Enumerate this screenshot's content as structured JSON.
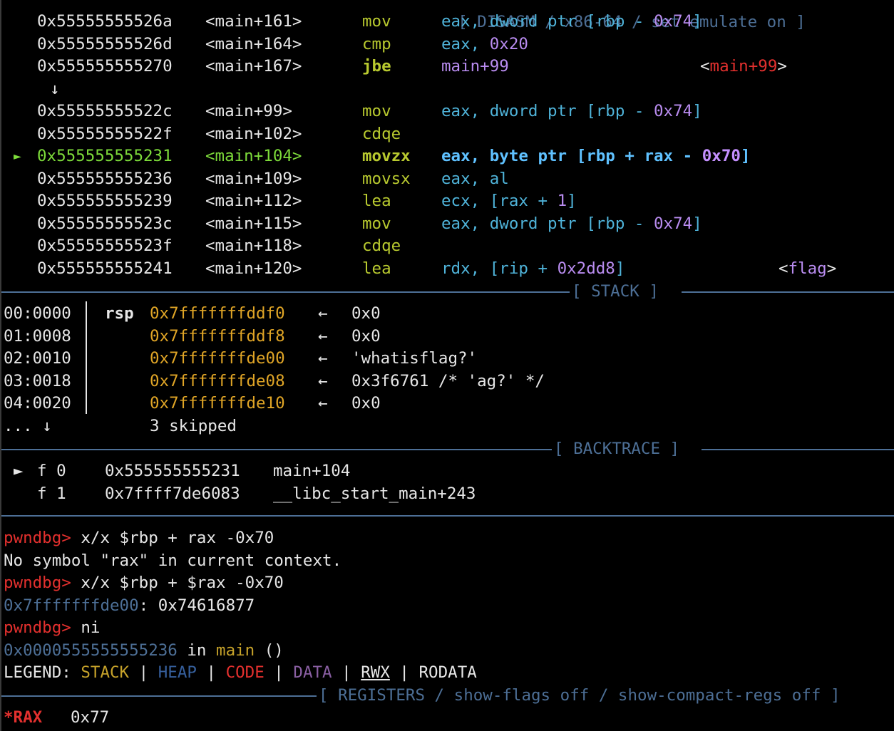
{
  "disasm": {
    "header": "[ DISASM / x86-64 / set emulate on ]",
    "rows": [
      {
        "addr": "0x55555555526a",
        "sym": "<main+161>",
        "mnem": "mov",
        "ops": [
          [
            "reg",
            "eax, dword ptr [rbp - "
          ],
          [
            "num",
            "0x74"
          ],
          [
            "reg",
            "]"
          ]
        ],
        "comment": ""
      },
      {
        "addr": "0x55555555526d",
        "sym": "<main+164>",
        "mnem": "cmp",
        "ops": [
          [
            "reg",
            "eax, "
          ],
          [
            "num",
            "0x20"
          ]
        ],
        "comment": ""
      },
      {
        "addr": "0x555555555270",
        "sym": "<main+167>",
        "mnem": "jbe",
        "ops": [
          [
            "num",
            "main+99"
          ]
        ],
        "comment": "<main+99>"
      },
      {
        "addr": "",
        "sym": "",
        "mnem": "",
        "ops": [],
        "comment": "",
        "arrow": "↓"
      },
      {
        "addr": "0x55555555522c",
        "sym": "<main+99>",
        "mnem": "mov",
        "ops": [
          [
            "reg",
            "eax, dword ptr [rbp - "
          ],
          [
            "num",
            "0x74"
          ],
          [
            "reg",
            "]"
          ]
        ],
        "comment": ""
      },
      {
        "addr": "0x55555555522f",
        "sym": "<main+102>",
        "mnem": "cdqe",
        "ops": [],
        "comment": ""
      },
      {
        "addr": "0x555555555231",
        "sym": "<main+104>",
        "mnem": "movzx",
        "ops": [
          [
            "reg",
            "eax, byte ptr [rbp + rax - "
          ],
          [
            "num",
            "0x70"
          ],
          [
            "reg",
            "]"
          ]
        ],
        "comment": "",
        "current": true
      },
      {
        "addr": "0x555555555236",
        "sym": "<main+109>",
        "mnem": "movsx",
        "ops": [
          [
            "reg",
            "eax, al"
          ]
        ],
        "comment": ""
      },
      {
        "addr": "0x555555555239",
        "sym": "<main+112>",
        "mnem": "lea",
        "ops": [
          [
            "reg",
            "ecx, [rax + "
          ],
          [
            "num",
            "1"
          ],
          [
            "reg",
            "]"
          ]
        ],
        "comment": ""
      },
      {
        "addr": "0x55555555523c",
        "sym": "<main+115>",
        "mnem": "mov",
        "ops": [
          [
            "reg",
            "eax, dword ptr [rbp - "
          ],
          [
            "num",
            "0x74"
          ],
          [
            "reg",
            "]"
          ]
        ],
        "comment": ""
      },
      {
        "addr": "0x55555555523f",
        "sym": "<main+118>",
        "mnem": "cdqe",
        "ops": [],
        "comment": ""
      },
      {
        "addr": "0x555555555241",
        "sym": "<main+120>",
        "mnem": "lea",
        "ops": [
          [
            "reg",
            "rdx, [rip + "
          ],
          [
            "num",
            "0x2dd8"
          ],
          [
            "reg",
            "]"
          ]
        ],
        "comment": "<flag>"
      }
    ]
  },
  "stack": {
    "header": "[ STACK ]",
    "rows": [
      {
        "offset": "00:0000",
        "reg": "rsp",
        "addr": "0x7fffffffddf0",
        "arrow": "←",
        "value": "0x0"
      },
      {
        "offset": "01:0008",
        "reg": "",
        "addr": "0x7fffffffddf8",
        "arrow": "←",
        "value": "0x0"
      },
      {
        "offset": "02:0010",
        "reg": "",
        "addr": "0x7fffffffde00",
        "arrow": "←",
        "value": "'whatisflag?'"
      },
      {
        "offset": "03:0018",
        "reg": "",
        "addr": "0x7fffffffde08",
        "arrow": "←",
        "value": "0x3f6761 /* 'ag?' */"
      },
      {
        "offset": "04:0020",
        "reg": "",
        "addr": "0x7fffffffde10",
        "arrow": "←",
        "value": "0x0"
      }
    ],
    "skipped_prefix": "... ↓",
    "skipped_text": "3 skipped"
  },
  "backtrace": {
    "header": "[ BACKTRACE ]",
    "frames": [
      {
        "marker": "►",
        "frame": "f 0",
        "addr": "0x555555555231",
        "sym": "main+104"
      },
      {
        "marker": "",
        "frame": "f 1",
        "addr": "0x7ffff7de6083",
        "sym": "__libc_start_main+243"
      }
    ]
  },
  "console": {
    "prompt": "pwndbg>",
    "lines": [
      {
        "kind": "cmd",
        "text": " x/x $rbp + rax -0x70"
      },
      {
        "kind": "out",
        "text": "No symbol \"rax\" in current context."
      },
      {
        "kind": "cmd",
        "text": " x/x $rbp + $rax -0x70"
      },
      {
        "kind": "mem",
        "addr": "0x7fffffffde00",
        "text": ": 0x74616877"
      },
      {
        "kind": "cmd",
        "text": " ni"
      },
      {
        "kind": "loc",
        "addr": "0x0000555555555236",
        "mid": " in ",
        "fn": "main",
        "tail": " ()"
      }
    ]
  },
  "legend": {
    "label": "LEGEND: ",
    "items": [
      {
        "text": "STACK",
        "color": "#c6a22a"
      },
      {
        "text": "HEAP",
        "color": "#365f9c"
      },
      {
        "text": "CODE",
        "color": "#e3302e"
      },
      {
        "text": "DATA",
        "color": "#8a5fa3"
      },
      {
        "text": "RWX",
        "color": "#e6e6e6"
      },
      {
        "text": "RODATA",
        "color": "#e6e6e6"
      }
    ],
    "sep": " | "
  },
  "registers": {
    "header": "[ REGISTERS / show-flags off / show-compact-regs off ]",
    "rows": [
      {
        "name": "*RAX",
        "value": "0x77"
      }
    ]
  },
  "colors": {
    "background": "#000000",
    "mnemonic": "#b8c92f",
    "register": "#4fb3d9",
    "number": "#b98cf0",
    "current": "#7ddb3a",
    "prompt": "#e3302e",
    "stack": "#e0a526",
    "divider": "#4d6f96"
  }
}
